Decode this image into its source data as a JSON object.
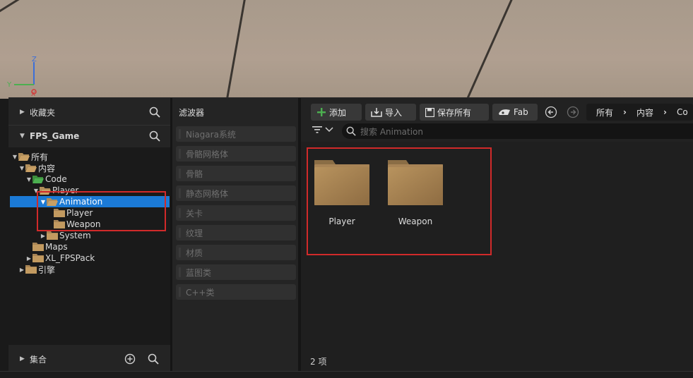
{
  "viewport": {
    "axis_labels": {
      "z": "Z",
      "y": "Y",
      "x": "X"
    }
  },
  "left_panel": {
    "favorites_label": "收藏夹",
    "project_label": "FPS_Game",
    "collections_label": "集合",
    "tree": [
      {
        "label": "所有",
        "expanded": true
      },
      {
        "label": "内容",
        "expanded": true
      },
      {
        "label": "Code",
        "expanded": true
      },
      {
        "label": "Player",
        "expanded": true
      },
      {
        "label": "Animation",
        "expanded": true,
        "selected": true
      },
      {
        "label": "Player"
      },
      {
        "label": "Weapon"
      },
      {
        "label": "System",
        "expanded": false
      },
      {
        "label": "Maps"
      },
      {
        "label": "XL_FPSPack",
        "expanded": false
      },
      {
        "label": "引擎",
        "expanded": false
      }
    ]
  },
  "filter_panel": {
    "title": "滤波器",
    "items": [
      "Niagara系统",
      "骨骼网格体",
      "骨骼",
      "静态网格体",
      "关卡",
      "纹理",
      "材质",
      "蓝图类",
      "C++类"
    ]
  },
  "toolbar": {
    "add_label": "添加",
    "import_label": "导入",
    "save_all_label": "保存所有",
    "fab_label": "Fab"
  },
  "breadcrumb": [
    "所有",
    "内容",
    "Co"
  ],
  "search": {
    "placeholder": "搜索 Animation"
  },
  "content": {
    "items": [
      {
        "label": "Player"
      },
      {
        "label": "Weapon"
      }
    ],
    "count_text": "2 项"
  },
  "colors": {
    "selection": "#1b7ad6",
    "highlight_box": "#d12a2a",
    "folder": "#b08d5a",
    "add_icon": "#4caf50"
  }
}
